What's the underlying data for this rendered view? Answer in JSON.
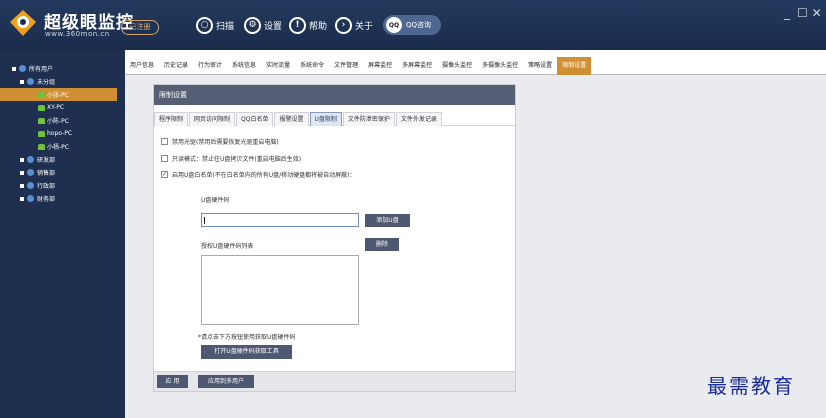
{
  "titlebar": {
    "brand": "超级眼监控",
    "url": "www.360mon.cn",
    "register_label": "已注册",
    "items": [
      {
        "icon": "search-icon",
        "label": "扫描"
      },
      {
        "icon": "gear-icon",
        "label": "设置"
      },
      {
        "icon": "help-icon",
        "label": "帮助"
      },
      {
        "icon": "info-icon",
        "label": "关于"
      }
    ],
    "qq_label": "QQ咨询",
    "minimize": "_",
    "close": "☐ ✕"
  },
  "sidebar": {
    "items": [
      {
        "label": "所有用户",
        "level": 0,
        "type": "group"
      },
      {
        "label": "未分组",
        "level": 1,
        "type": "group"
      },
      {
        "label": "小张-PC",
        "level": 2,
        "type": "user",
        "selected": true
      },
      {
        "label": "XY-PC",
        "level": 2,
        "type": "user"
      },
      {
        "label": "小陈-PC",
        "level": 2,
        "type": "user"
      },
      {
        "label": "hopo-PC",
        "level": 2,
        "type": "user"
      },
      {
        "label": "小杨-PC",
        "level": 2,
        "type": "user"
      },
      {
        "label": "研发部",
        "level": 1,
        "type": "group"
      },
      {
        "label": "销售部",
        "level": 1,
        "type": "group"
      },
      {
        "label": "行政部",
        "level": 1,
        "type": "group"
      },
      {
        "label": "财务部",
        "level": 1,
        "type": "group"
      }
    ]
  },
  "tabs": [
    "用户信息",
    "历史记录",
    "行为审计",
    "系统信息",
    "实时流量",
    "系统命令",
    "文件管理",
    "屏幕监控",
    "多屏幕监控",
    "摄像头监控",
    "多摄像头监控",
    "策略设置",
    "限制设置"
  ],
  "active_tab": "限制设置",
  "panel": {
    "title": "限制设置",
    "subtabs": [
      "程序限制",
      "网页访问限制",
      "QQ白名单",
      "报警设置",
      "U盘限制",
      "文件防泄密保护",
      "文件外发记录"
    ],
    "active_subtab": "U盘限制",
    "options": [
      {
        "label": "禁用光驱(禁用后需要恢复光驱重启电脑)",
        "checked": false
      },
      {
        "label": "只读模式：禁止往U盘拷贝文件(重启电脑后生效)",
        "checked": false
      },
      {
        "label": "启用U盘白名单(不在白名单内的所有U盘/移动硬盘都将被自动屏蔽)：",
        "checked": true
      }
    ],
    "usb_code_label": "U盘硬件码",
    "usb_code_value": "",
    "add_button": "添加U盘",
    "delete_button": "删除",
    "list_label": "授权U盘硬件码列表",
    "hint": "*请点击下方按钮使用获取U盘硬件码",
    "tool_button": "打开U盘硬件码获取工具",
    "apply_button": "应 用",
    "apply_all_button": "应用到多用户"
  },
  "watermark": "最需教育"
}
